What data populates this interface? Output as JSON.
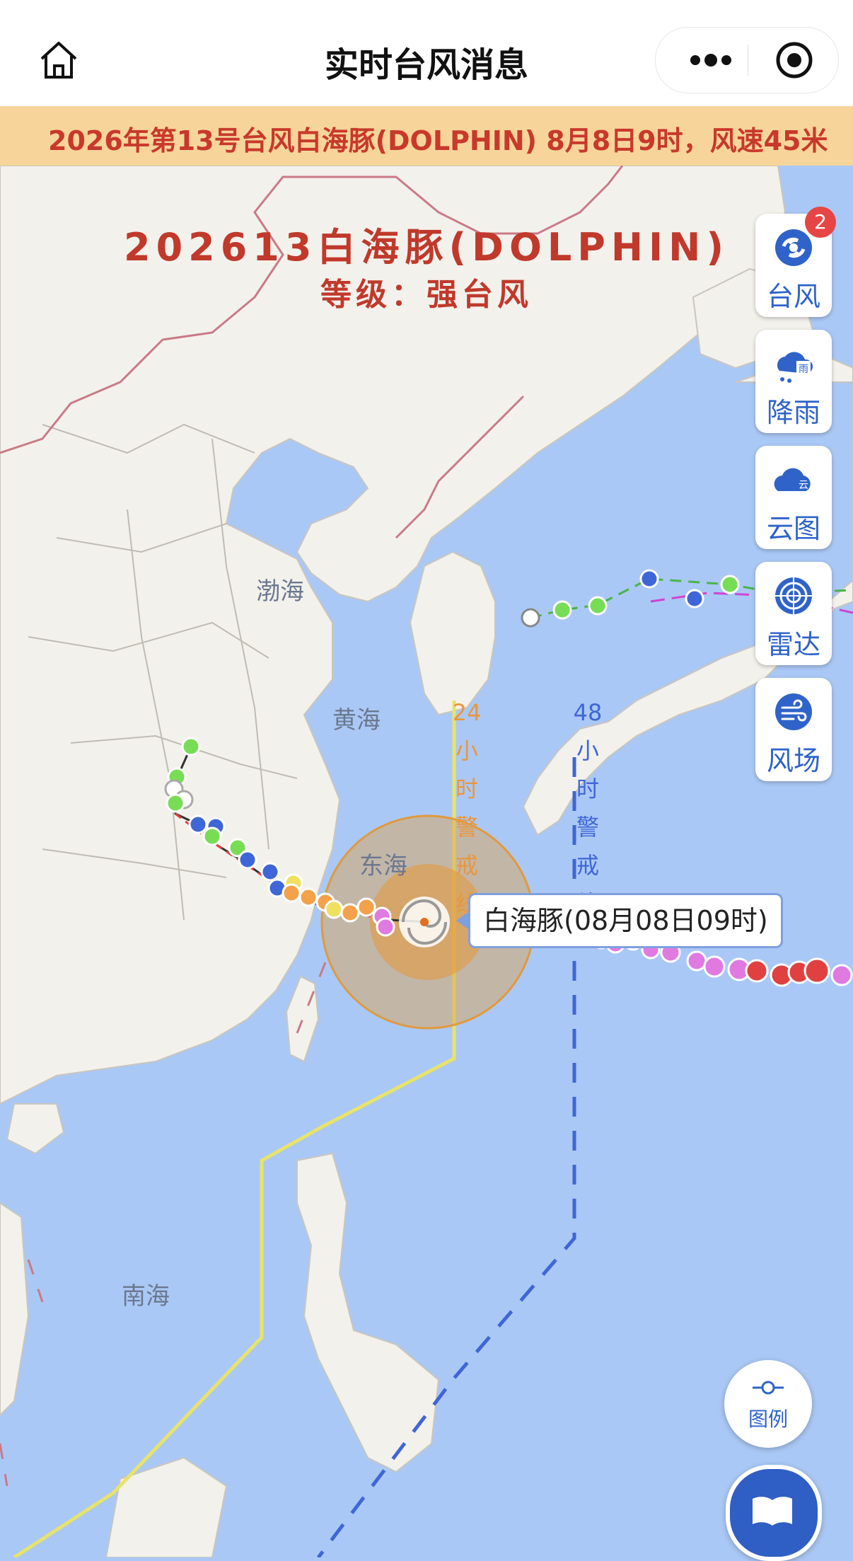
{
  "header": {
    "title": "实时台风消息",
    "home_icon": "home-icon",
    "more_icon": "more-dots-icon",
    "close_icon": "target-close-icon"
  },
  "marquee": {
    "text": "2026年第13号台风白海豚(DOLPHIN)   8月8日9时，风速45米"
  },
  "storm": {
    "title": "202613白海豚(DOLPHIN)",
    "level": "等级：强台风",
    "position_label": "白海豚(08月08日09时)"
  },
  "sea_labels": {
    "bohai": "渤海",
    "huanghai": "黄海",
    "donghai": "东海",
    "nanhai": "南海"
  },
  "warning_lines": {
    "h24": {
      "hours": "24",
      "chars": [
        "小",
        "时",
        "警",
        "戒",
        "线"
      ],
      "color": "#e8e36a"
    },
    "h48": {
      "hours": "48",
      "chars": [
        "小",
        "时",
        "警",
        "戒",
        "线"
      ],
      "color": "#3f66d6"
    }
  },
  "side_buttons": [
    {
      "label": "台风",
      "icon": "typhoon-icon",
      "badge": "2"
    },
    {
      "label": "降雨",
      "icon": "rain-cloud-icon"
    },
    {
      "label": "云图",
      "icon": "cloud-icon"
    },
    {
      "label": "雷达",
      "icon": "radar-icon"
    },
    {
      "label": "风场",
      "icon": "wind-icon"
    }
  ],
  "bottom_buttons": {
    "legend_label": "图例",
    "legend_icon": "legend-slider-icon",
    "book_icon": "book-icon"
  },
  "colors": {
    "accent": "#2f63c9",
    "title_red": "#c0392b",
    "marquee_bg": "#f7d59a",
    "sea": "#aac8f5",
    "land": "#f3f1ec"
  }
}
